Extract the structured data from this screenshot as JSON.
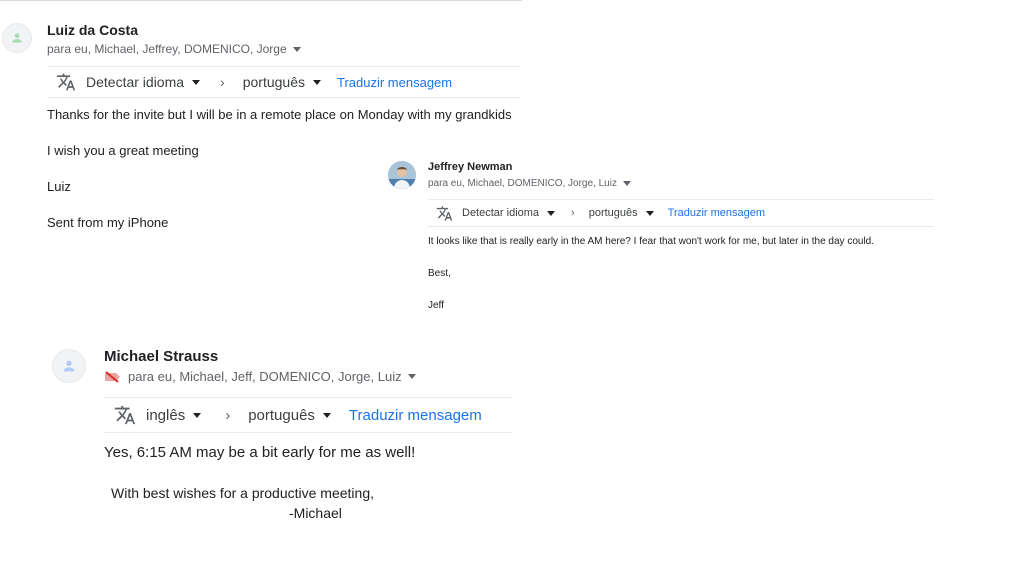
{
  "messages": [
    {
      "sender": "Luiz da Costa",
      "recipients": "para eu, Michael, Jeffrey, DOMENICO, Jorge",
      "translate": {
        "source_lang": "Detectar idioma",
        "target_lang": "português",
        "action": "Traduzir mensagem"
      },
      "body": [
        "Thanks for the invite but I will be in a remote place on Monday with my grandkids",
        "I wish you a great meeting",
        "Luiz",
        "Sent from my iPhone"
      ]
    },
    {
      "sender": "Jeffrey Newman",
      "recipients": "para eu, Michael, DOMENICO, Jorge, Luiz",
      "translate": {
        "source_lang": "Detectar idioma",
        "target_lang": "português",
        "action": "Traduzir mensagem"
      },
      "body": [
        "It looks like that is really early in the AM here?  I fear that won't work for me, but later in the day could.",
        "Best,",
        "Jeff"
      ]
    },
    {
      "sender": "Michael Strauss",
      "recipients": "para eu, Michael, Jeff, DOMENICO, Jorge, Luiz",
      "translate": {
        "source_lang": "inglês",
        "target_lang": "português",
        "action": "Traduzir mensagem"
      },
      "body": [
        "Yes, 6:15 AM may be a bit early for me as well!",
        "With best wishes for a productive meeting,",
        "-Michael"
      ]
    }
  ],
  "icons": {
    "translate": "translate-icon",
    "avatar": "person-icon",
    "label": "important-label-icon"
  },
  "colors": {
    "link": "#1a73e8",
    "muted": "#5f6368",
    "divider": "#e8eaed"
  }
}
